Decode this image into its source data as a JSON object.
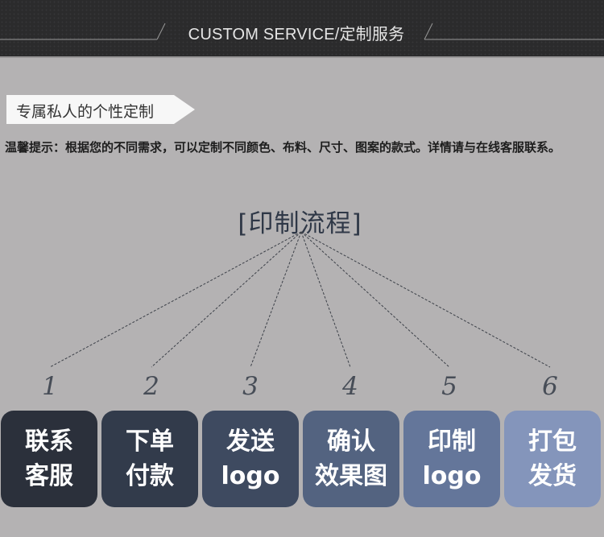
{
  "header": {
    "title": "CUSTOM SERVICE/定制服务"
  },
  "tag": {
    "label": "专属私人的个性定制"
  },
  "tip": {
    "text": "温馨提示：根据您的不同需求，可以定制不同颜色、布料、尺寸、图案的款式。详情请与在线客服联系。"
  },
  "process": {
    "title": "[印制流程]",
    "steps": [
      {
        "number": "1",
        "line1": "联系",
        "line2": "客服",
        "color": "#2b303b"
      },
      {
        "number": "2",
        "line1": "下单",
        "line2": "付款",
        "color": "#323b4b"
      },
      {
        "number": "3",
        "line1": "发送",
        "line2": "logo",
        "color": "#3e4a60"
      },
      {
        "number": "4",
        "line1": "确认",
        "line2": "效果图",
        "color": "#536380"
      },
      {
        "number": "5",
        "line1": "印制",
        "line2": "logo",
        "color": "#64769a"
      },
      {
        "number": "6",
        "line1": "打包",
        "line2": "发货",
        "color": "#8495bb"
      }
    ]
  }
}
